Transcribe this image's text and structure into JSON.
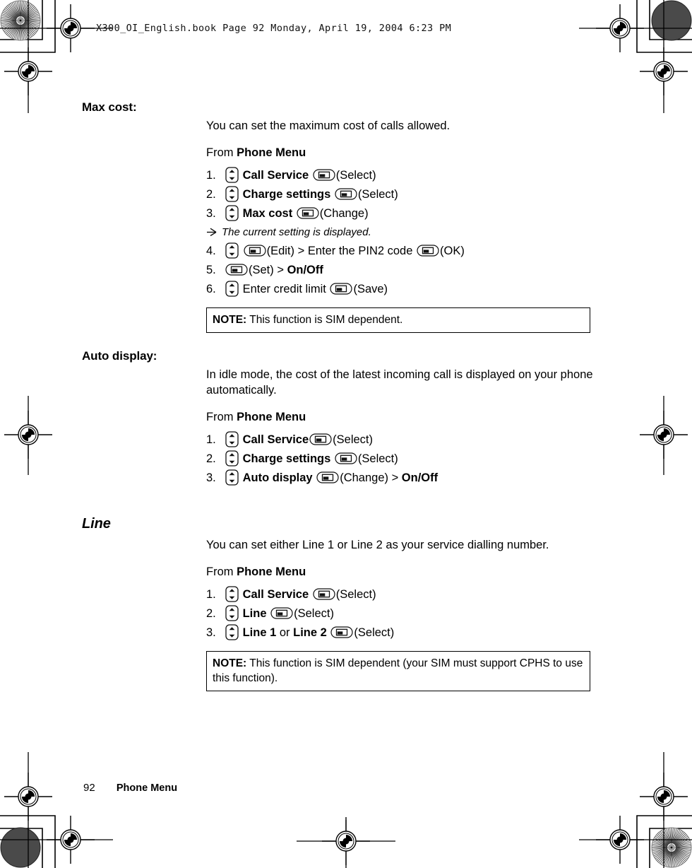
{
  "book_header": "X300_OI_English.book  Page 92  Monday, April 19, 2004  6:23 PM",
  "footer": {
    "page_number": "92",
    "chapter": "Phone Menu"
  },
  "icons": {
    "updown_key": "updown-navigation-key-icon",
    "select_key": "select-softkey-icon",
    "bullet_arrow": "arrow-bullet-icon"
  },
  "sections": [
    {
      "id": "max-cost",
      "title": "Max cost:",
      "style": "bold",
      "intro": "You can set the maximum cost of calls allowed.",
      "from_prefix": "From ",
      "from_menu": "Phone Menu",
      "steps": [
        {
          "num": "1.",
          "parts": [
            {
              "t": "key",
              "k": "updown"
            },
            {
              "t": "sp"
            },
            {
              "t": "b",
              "v": "Call Service"
            },
            {
              "t": "sp"
            },
            {
              "t": "key",
              "k": "select"
            },
            {
              "t": "n",
              "v": "(Select)"
            }
          ]
        },
        {
          "num": "2.",
          "parts": [
            {
              "t": "key",
              "k": "updown"
            },
            {
              "t": "sp"
            },
            {
              "t": "b",
              "v": "Charge settings"
            },
            {
              "t": "sp"
            },
            {
              "t": "key",
              "k": "select"
            },
            {
              "t": "n",
              "v": "(Select)"
            }
          ]
        },
        {
          "num": "3.",
          "parts": [
            {
              "t": "key",
              "k": "updown"
            },
            {
              "t": "sp"
            },
            {
              "t": "b",
              "v": "Max cost"
            },
            {
              "t": "sp"
            },
            {
              "t": "key",
              "k": "select"
            },
            {
              "t": "n",
              "v": "(Change)"
            }
          ]
        },
        {
          "num": "bullet",
          "note": "The current setting is displayed."
        },
        {
          "num": "4.",
          "parts": [
            {
              "t": "key",
              "k": "updown"
            },
            {
              "t": "sp"
            },
            {
              "t": "key",
              "k": "select"
            },
            {
              "t": "n",
              "v": "(Edit) > Enter the PIN2 code "
            },
            {
              "t": "key",
              "k": "select"
            },
            {
              "t": "n",
              "v": "(OK)"
            }
          ]
        },
        {
          "num": "5.",
          "parts": [
            {
              "t": "key",
              "k": "select"
            },
            {
              "t": "n",
              "v": "(Set) > "
            },
            {
              "t": "b",
              "v": "On/Off"
            }
          ]
        },
        {
          "num": "6.",
          "parts": [
            {
              "t": "key",
              "k": "updown"
            },
            {
              "t": "n",
              "v": " Enter credit limit "
            },
            {
              "t": "key",
              "k": "select"
            },
            {
              "t": "n",
              "v": "(Save)"
            }
          ]
        }
      ],
      "note": {
        "label": "NOTE:",
        "text": " This function is SIM dependent."
      }
    },
    {
      "id": "auto-display",
      "title": "Auto display:",
      "style": "bold",
      "intro": "In idle mode, the cost of the latest incoming call is displayed on your phone automatically.",
      "from_prefix": "From ",
      "from_menu": "Phone Menu",
      "steps": [
        {
          "num": "1.",
          "parts": [
            {
              "t": "key",
              "k": "updown"
            },
            {
              "t": "sp"
            },
            {
              "t": "b",
              "v": "Call Service"
            },
            {
              "t": "key",
              "k": "select"
            },
            {
              "t": "n",
              "v": "(Select)"
            }
          ]
        },
        {
          "num": "2.",
          "parts": [
            {
              "t": "key",
              "k": "updown"
            },
            {
              "t": "sp"
            },
            {
              "t": "b",
              "v": "Charge settings"
            },
            {
              "t": "sp"
            },
            {
              "t": "key",
              "k": "select"
            },
            {
              "t": "n",
              "v": "(Select)"
            }
          ]
        },
        {
          "num": "3.",
          "parts": [
            {
              "t": "key",
              "k": "updown"
            },
            {
              "t": "sp"
            },
            {
              "t": "b",
              "v": "Auto display"
            },
            {
              "t": "sp"
            },
            {
              "t": "key",
              "k": "select"
            },
            {
              "t": "n",
              "v": "(Change) > "
            },
            {
              "t": "b",
              "v": "On/Off"
            }
          ]
        }
      ],
      "note": null
    },
    {
      "id": "line",
      "title": "Line",
      "style": "italic",
      "intro": "You can set either Line 1 or Line 2 as your service dialling number.",
      "from_prefix": "From ",
      "from_menu": "Phone Menu",
      "steps": [
        {
          "num": "1.",
          "parts": [
            {
              "t": "key",
              "k": "updown"
            },
            {
              "t": "sp"
            },
            {
              "t": "b",
              "v": "Call Service"
            },
            {
              "t": "sp"
            },
            {
              "t": "key",
              "k": "select"
            },
            {
              "t": "n",
              "v": "(Select)"
            }
          ]
        },
        {
          "num": "2.",
          "parts": [
            {
              "t": "key",
              "k": "updown"
            },
            {
              "t": "sp"
            },
            {
              "t": "b",
              "v": "Line"
            },
            {
              "t": "sp"
            },
            {
              "t": "key",
              "k": "select"
            },
            {
              "t": "n",
              "v": "(Select)"
            }
          ]
        },
        {
          "num": "3.",
          "parts": [
            {
              "t": "key",
              "k": "updown"
            },
            {
              "t": "sp"
            },
            {
              "t": "b",
              "v": "Line 1"
            },
            {
              "t": "n",
              "v": " or "
            },
            {
              "t": "b",
              "v": "Line 2"
            },
            {
              "t": "sp"
            },
            {
              "t": "key",
              "k": "select"
            },
            {
              "t": "n",
              "v": "(Select)"
            }
          ]
        }
      ],
      "note": {
        "label": "NOTE:",
        "text": " This function is SIM dependent (your SIM must support CPHS to use this function)."
      }
    }
  ]
}
